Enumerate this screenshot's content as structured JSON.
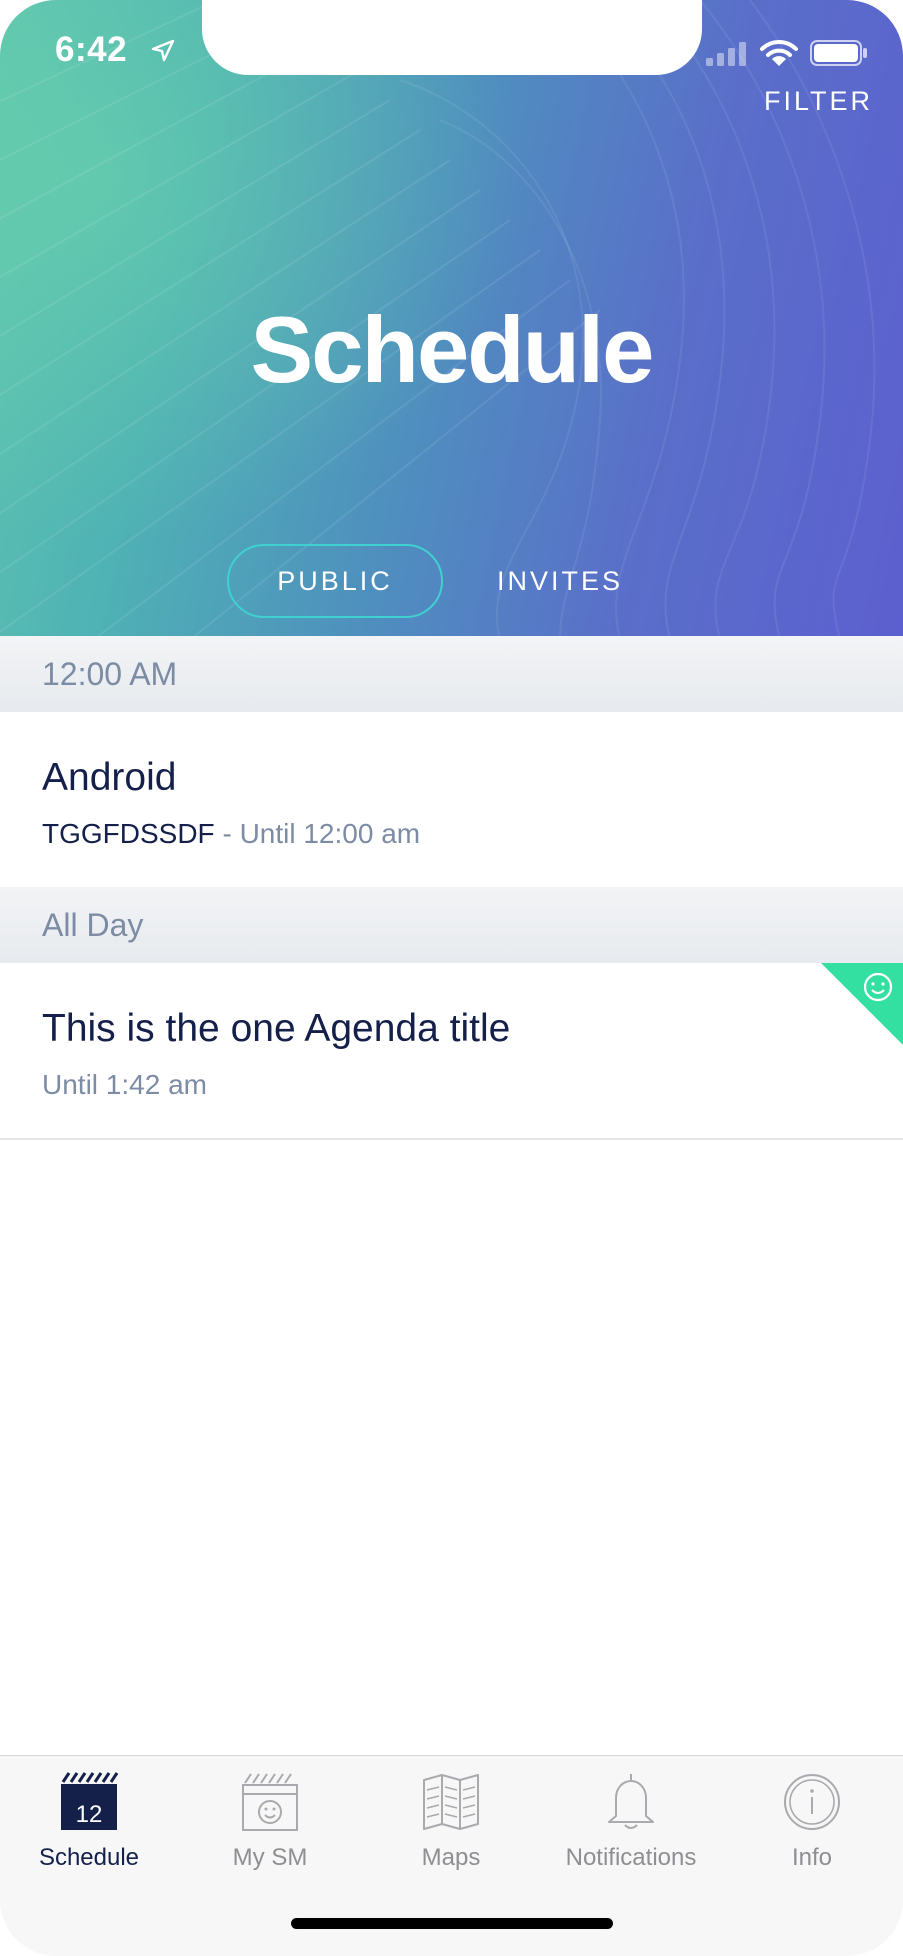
{
  "status_bar": {
    "time": "6:42"
  },
  "header": {
    "filter_label": "FILTER",
    "title": "Schedule",
    "tabs": [
      {
        "label": "PUBLIC",
        "selected": true
      },
      {
        "label": "INVITES",
        "selected": false
      }
    ]
  },
  "sections": [
    {
      "header": "12:00 AM",
      "items": [
        {
          "title": "Android",
          "location": "TGGFDSSDF",
          "separator": " - ",
          "time": "Until 12:00 am",
          "badge": false
        }
      ]
    },
    {
      "header": "All Day",
      "items": [
        {
          "title": "This is the one Agenda title",
          "location": "",
          "separator": "",
          "time": "Until 1:42 am",
          "badge": true,
          "badge_icon": "smiley-icon"
        }
      ]
    }
  ],
  "tabbar": {
    "items": [
      {
        "label": "Schedule",
        "icon": "calendar-icon",
        "icon_text": "12",
        "active": true
      },
      {
        "label": "My SM",
        "icon": "my-calendar-smiley-icon",
        "active": false
      },
      {
        "label": "Maps",
        "icon": "map-icon",
        "active": false
      },
      {
        "label": "Notifications",
        "icon": "bell-icon",
        "active": false
      },
      {
        "label": "Info",
        "icon": "info-icon",
        "active": false
      }
    ]
  },
  "colors": {
    "accent_teal": "#3fd1cf",
    "badge_green": "#33e0a1",
    "navy_text": "#14204a",
    "muted_text": "#7c8ca4"
  }
}
